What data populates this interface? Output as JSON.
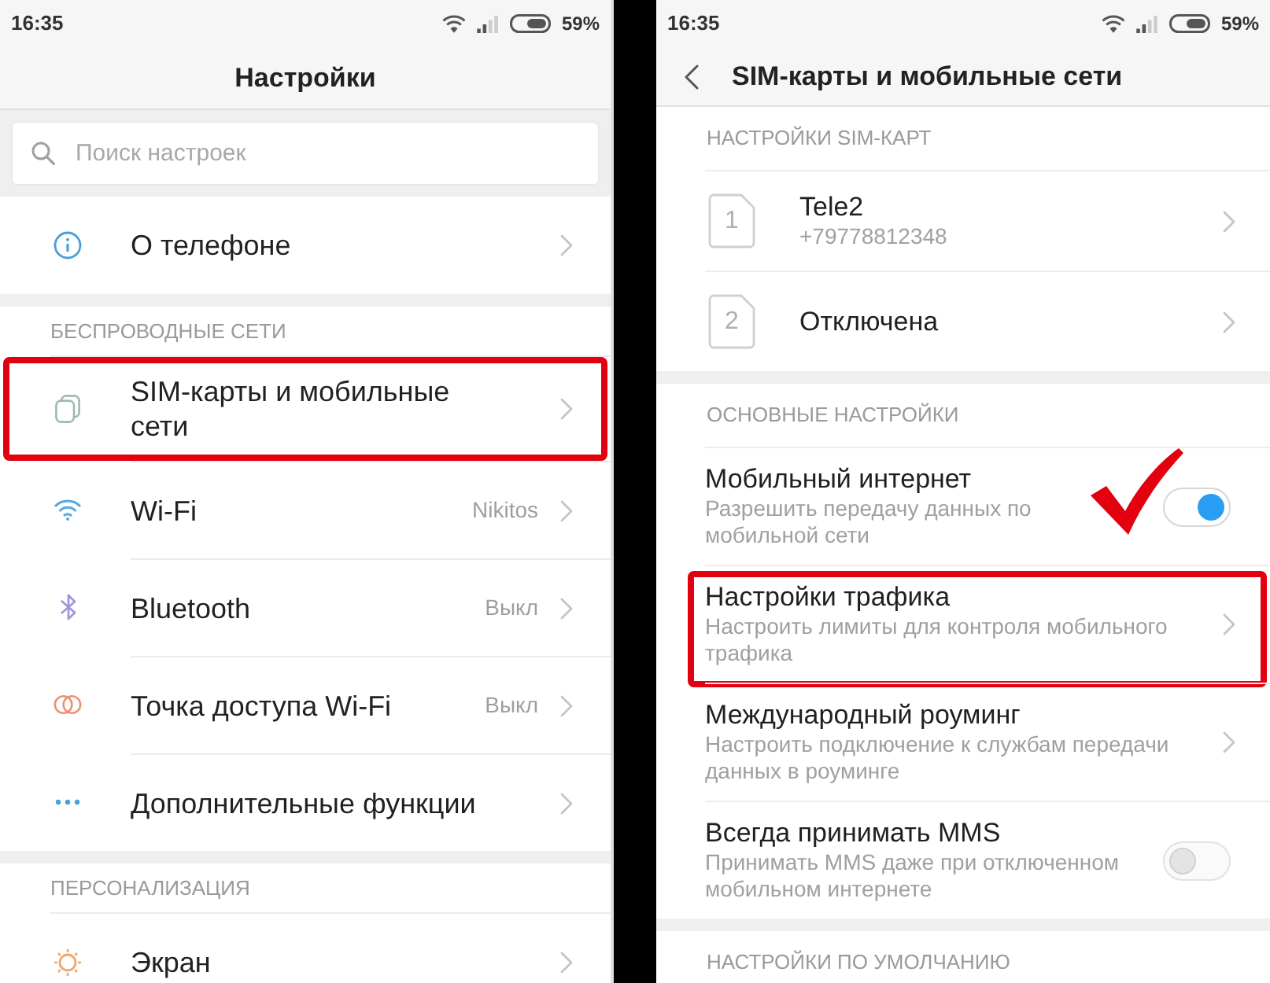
{
  "settings_screen": {
    "status_bar": {
      "time": "16:35",
      "battery": "59%"
    },
    "title": "Настройки",
    "search": {
      "placeholder": "Поиск настроек"
    },
    "sections": [
      {
        "items": [
          {
            "label": "О телефоне",
            "highlighted": false
          }
        ]
      },
      {
        "header": "БЕСПРОВОДНЫЕ СЕТИ",
        "items": [
          {
            "label": "SIM-карты и мобильные сети",
            "highlighted": true
          },
          {
            "label": "Wi-Fi",
            "value": "Nikitos",
            "highlighted": false
          },
          {
            "label": "Bluetooth",
            "value": "Выкл",
            "highlighted": false
          },
          {
            "label": "Точка доступа Wi-Fi",
            "value": "Выкл",
            "highlighted": false
          },
          {
            "label": "Дополнительные функции",
            "highlighted": false
          }
        ]
      },
      {
        "header": "ПЕРСОНАЛИЗАЦИЯ",
        "items": [
          {
            "label": "Экран",
            "highlighted": false
          }
        ]
      }
    ]
  },
  "sim_screen": {
    "status_bar": {
      "time": "16:35",
      "battery": "59%"
    },
    "title": "SIM-карты и мобильные сети",
    "sections": [
      {
        "header": "НАСТРОЙКИ SIM-КАРТ",
        "items": [
          {
            "kind": "sim",
            "slot": "1",
            "label": "Tele2",
            "subtitle": "+79778812348",
            "highlighted": false,
            "ticked": false
          },
          {
            "kind": "sim",
            "slot": "2",
            "label": "Отключена",
            "highlighted": false,
            "ticked": false
          }
        ]
      },
      {
        "header": "ОСНОВНЫЕ НАСТРОЙКИ",
        "items": [
          {
            "kind": "toggle",
            "label": "Мобильный интернет",
            "subtitle": "Разрешить передачу данных по мобильной сети",
            "on": true,
            "highlighted": false,
            "ticked": true
          },
          {
            "kind": "link",
            "label": "Настройки трафика",
            "subtitle": "Настроить лимиты для контроля мобильного трафика",
            "highlighted": true,
            "ticked": false
          },
          {
            "kind": "link",
            "label": "Международный роуминг",
            "subtitle": "Настроить подключение к службам передачи данных в роуминге",
            "highlighted": false,
            "ticked": false
          },
          {
            "kind": "toggle",
            "label": "Всегда принимать MMS",
            "subtitle": "Принимать MMS даже при отключенном мобильном интернете",
            "on": false,
            "highlighted": false,
            "ticked": false
          }
        ]
      },
      {
        "header": "НАСТРОЙКИ ПО УМОЛЧАНИЮ"
      }
    ]
  }
}
